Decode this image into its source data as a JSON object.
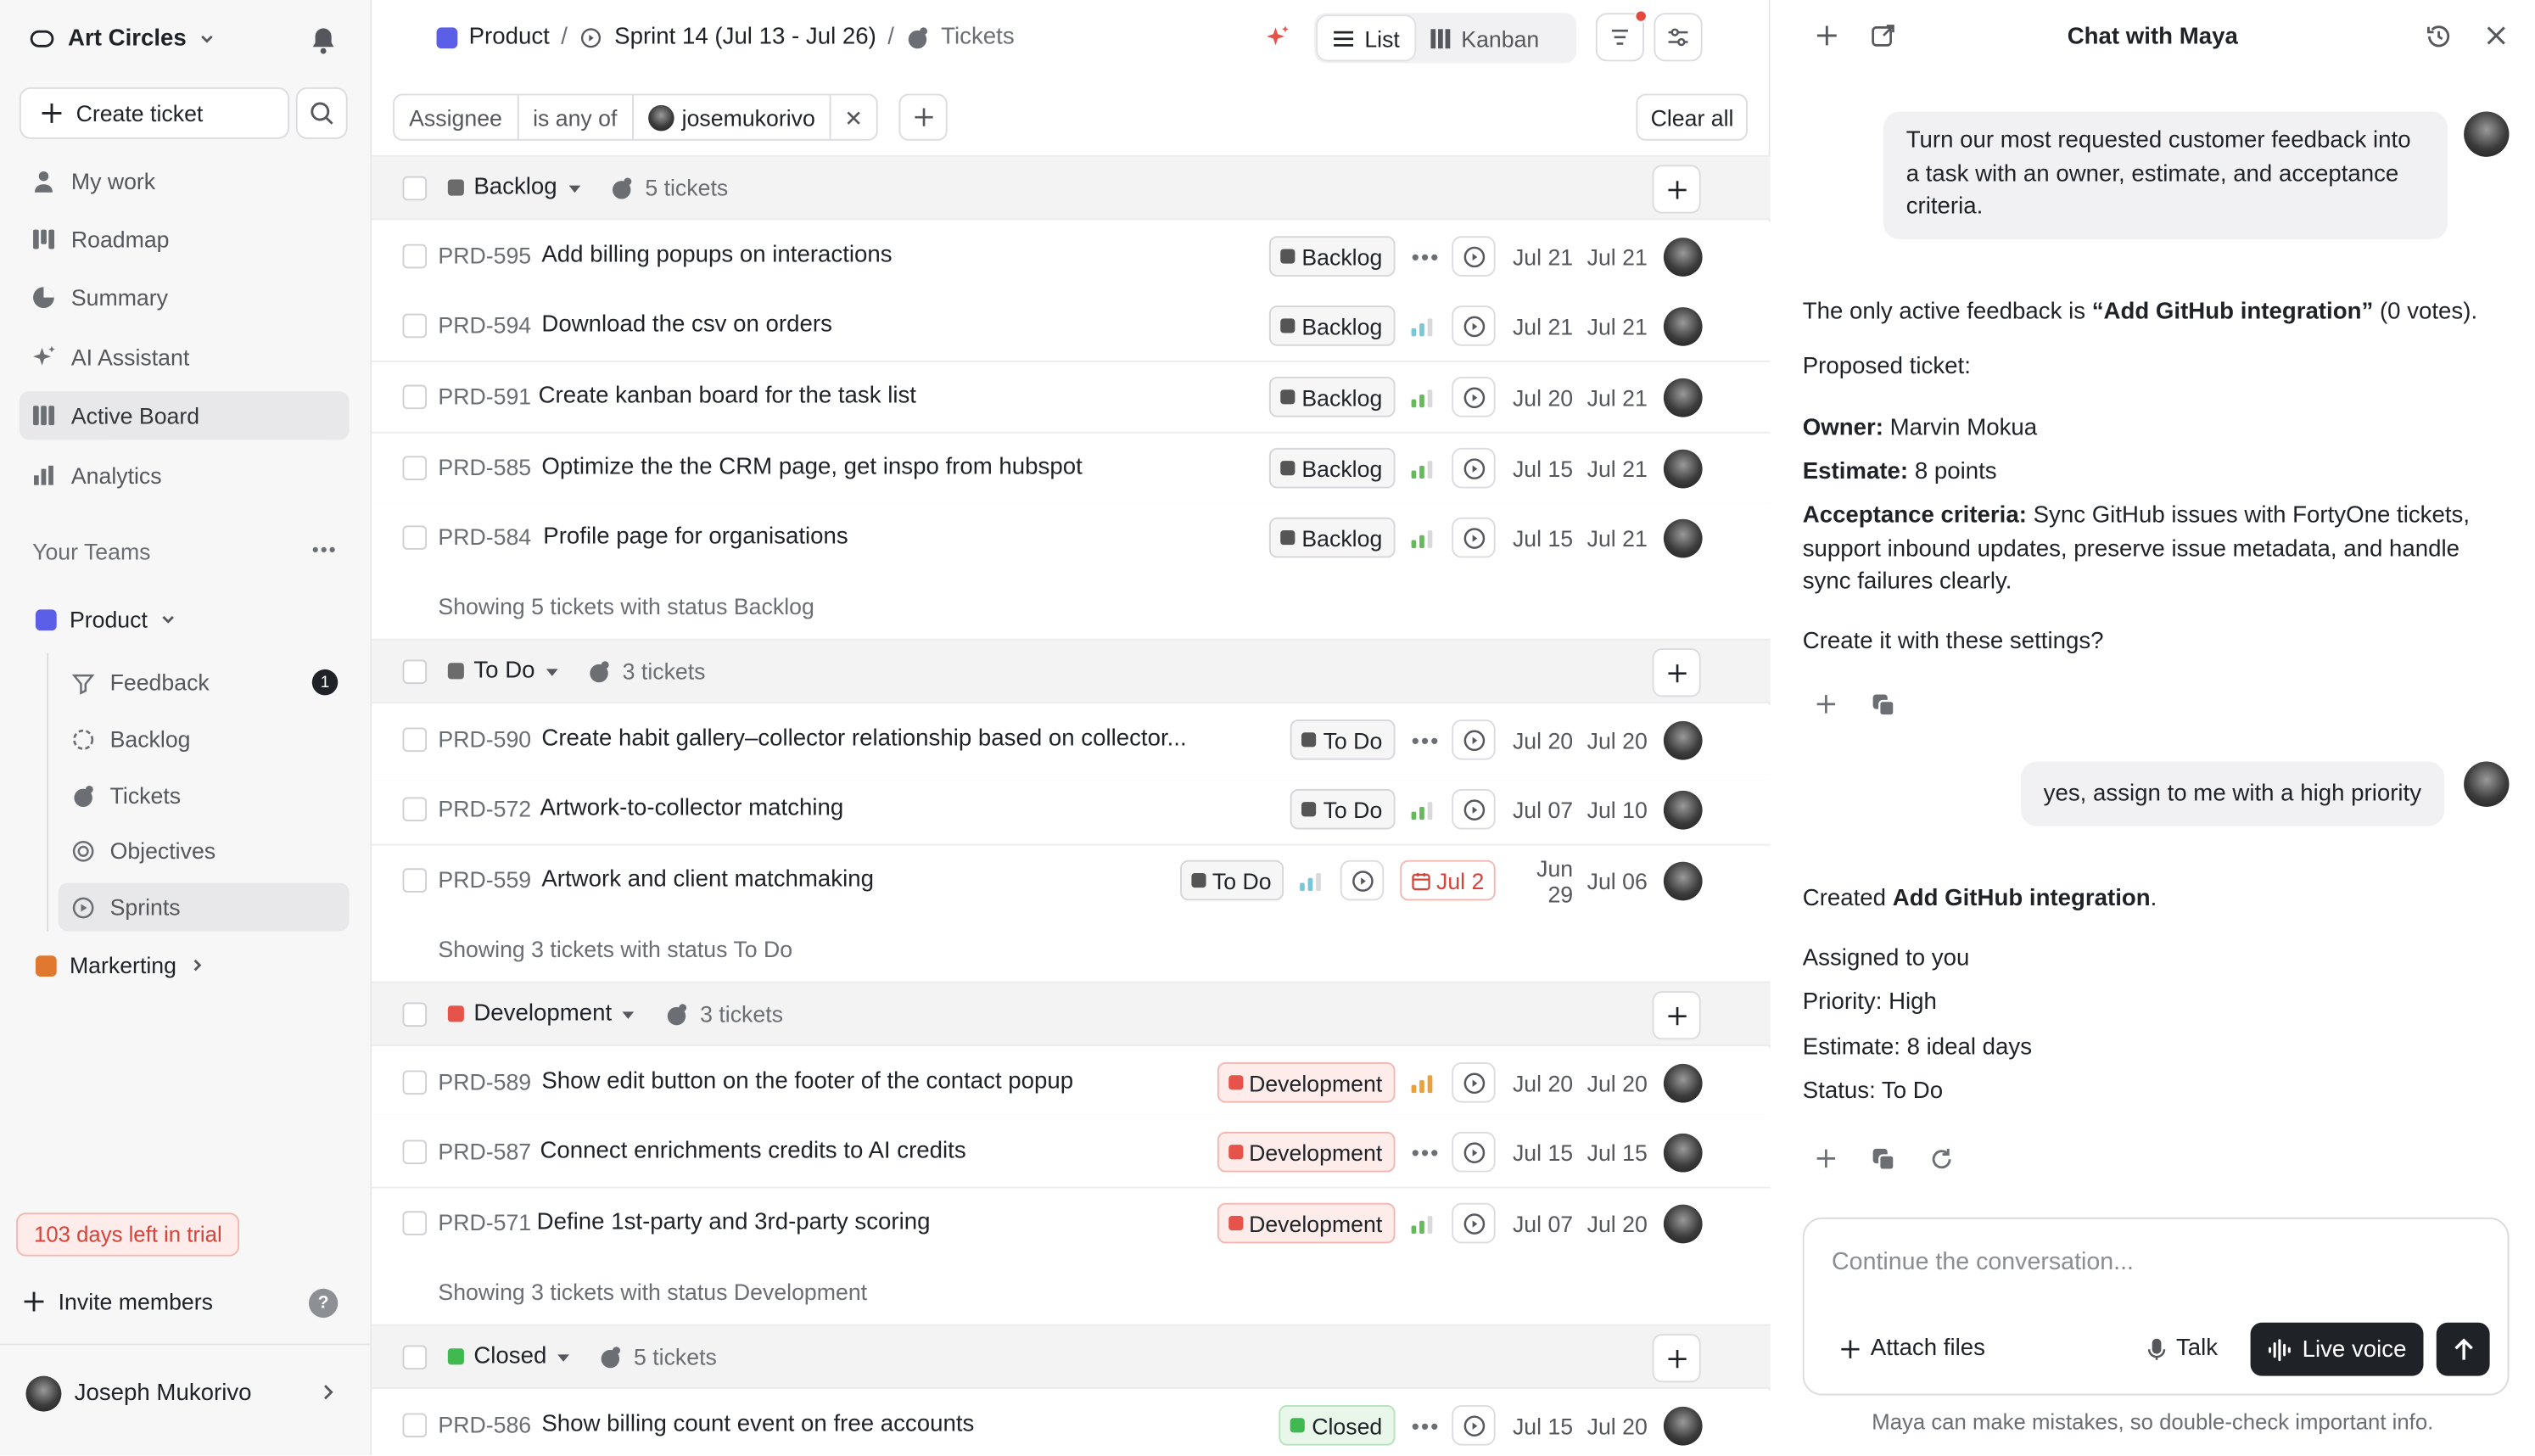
{
  "sidebar": {
    "workspace": "Art Circles",
    "create_ticket": "Create ticket",
    "nav": [
      {
        "label": "My work",
        "icon": "person-icon"
      },
      {
        "label": "Roadmap",
        "icon": "roadmap-icon"
      },
      {
        "label": "Summary",
        "icon": "pie-icon"
      },
      {
        "label": "AI Assistant",
        "icon": "sparkle-icon"
      },
      {
        "label": "Active Board",
        "icon": "board-icon"
      },
      {
        "label": "Analytics",
        "icon": "bar-chart-icon"
      }
    ],
    "your_teams": "Your Teams",
    "teams": [
      {
        "label": "Product",
        "color": "#5b5ee6"
      },
      {
        "label": "Markerting",
        "color": "#e0782f"
      }
    ],
    "product_items": [
      {
        "label": "Feedback",
        "badge": "1"
      },
      {
        "label": "Backlog"
      },
      {
        "label": "Tickets"
      },
      {
        "label": "Objectives"
      },
      {
        "label": "Sprints"
      }
    ],
    "trial": "103 days left in trial",
    "invite": "Invite members",
    "help": "?",
    "user": "Joseph Mukorivo"
  },
  "header": {
    "crumbs": [
      "Product",
      "/",
      "Sprint 14 (Jul 13 - Jul 26)",
      "/",
      "Tickets"
    ],
    "views": [
      "List",
      "Kanban"
    ]
  },
  "filter": {
    "field": "Assignee",
    "op": "is any of",
    "value": "josemukorivo",
    "clear": "Clear all"
  },
  "groups": [
    {
      "name": "Backlog",
      "color": "#6b6b6b",
      "count": "5 tickets",
      "footer": "Showing 5 tickets with status Backlog",
      "rows": [
        {
          "id": "PRD-595",
          "title": "Add billing popups on interactions",
          "status": "Backlog",
          "priority": "none",
          "start": "Jul 21",
          "end": "Jul 21"
        },
        {
          "id": "PRD-594",
          "title": "Download the csv on orders",
          "status": "Backlog",
          "priority": "low",
          "start": "Jul 21",
          "end": "Jul 21"
        },
        {
          "id": "PRD-591",
          "title": "Create kanban board for the task list",
          "status": "Backlog",
          "priority": "medium",
          "start": "Jul 20",
          "end": "Jul 21"
        },
        {
          "id": "PRD-585",
          "title": "Optimize the the CRM page, get inspo from hubspot",
          "status": "Backlog",
          "priority": "medium",
          "start": "Jul 15",
          "end": "Jul 21"
        },
        {
          "id": "PRD-584",
          "title": "Profile page for organisations",
          "status": "Backlog",
          "priority": "medium",
          "start": "Jul 15",
          "end": "Jul 21"
        }
      ]
    },
    {
      "name": "To Do",
      "color": "#6b6b6b",
      "count": "3 tickets",
      "footer": "Showing 3 tickets with status To Do",
      "rows": [
        {
          "id": "PRD-590",
          "title": "Create habit gallery–collector relationship based on collector...",
          "status": "To Do",
          "priority": "none",
          "start": "Jul 20",
          "end": "Jul 20"
        },
        {
          "id": "PRD-572",
          "title": "Artwork-to-collector matching",
          "status": "To Do",
          "priority": "medium",
          "start": "Jul 07",
          "end": "Jul 10"
        },
        {
          "id": "PRD-559",
          "title": "Artwork and client matchmaking",
          "status": "To Do",
          "priority": "low",
          "due": "Jul 2",
          "start": "Jun 29",
          "end": "Jul 06"
        }
      ]
    },
    {
      "name": "Development",
      "color": "#e5534b",
      "count": "3 tickets",
      "footer": "Showing 3 tickets with status Development",
      "rows": [
        {
          "id": "PRD-589",
          "title": "Show edit button on the footer of the contact popup",
          "status": "Development",
          "priority": "high",
          "start": "Jul 20",
          "end": "Jul 20"
        },
        {
          "id": "PRD-587",
          "title": "Connect enrichments credits to AI credits",
          "status": "Development",
          "priority": "none",
          "start": "Jul 15",
          "end": "Jul 15"
        },
        {
          "id": "PRD-571",
          "title": "Define 1st-party and 3rd-party scoring",
          "status": "Development",
          "priority": "medium",
          "start": "Jul 07",
          "end": "Jul 20"
        }
      ]
    },
    {
      "name": "Closed",
      "color": "#3fb950",
      "count": "5 tickets",
      "footer": "",
      "rows": [
        {
          "id": "PRD-586",
          "title": "Show billing count event on free accounts",
          "status": "Closed",
          "priority": "none",
          "start": "Jul 15",
          "end": "Jul 20"
        }
      ]
    }
  ],
  "chat": {
    "title": "Chat with Maya",
    "user_msg1": "Turn our most requested customer feedback into a task with an owner, estimate, and acceptance criteria.",
    "reply1_prefix": "The only active feedback is ",
    "reply1_bold": "“Add GitHub integration”",
    "reply1_suffix": " (0 votes).",
    "proposed": "Proposed ticket:",
    "owner_label": "Owner:",
    "owner": " Marvin Mokua",
    "estimate_label": "Estimate:",
    "estimate": " 8 points",
    "criteria_label": "Acceptance criteria:",
    "criteria": " Sync GitHub issues with FortyOne tickets, support inbound updates, preserve issue metadata, and handle sync failures clearly.",
    "confirm": "Create it with these settings?",
    "user_msg2": "yes, assign to me with a high priority",
    "created_prefix": "Created ",
    "created_bold": "Add GitHub integration",
    "created_suffix": ".",
    "assigned": "Assigned to you",
    "priority": "Priority: High",
    "estimate2": "Estimate: 8 ideal days",
    "status": "Status: To Do",
    "placeholder": "Continue the conversation...",
    "attach": "Attach files",
    "talk": "Talk",
    "live": "Live voice",
    "disclaimer": "Maya can make mistakes, so double-check important info."
  },
  "colors": {
    "accent": "#5b5ee6",
    "danger": "#e5534b",
    "success": "#3fb950"
  }
}
